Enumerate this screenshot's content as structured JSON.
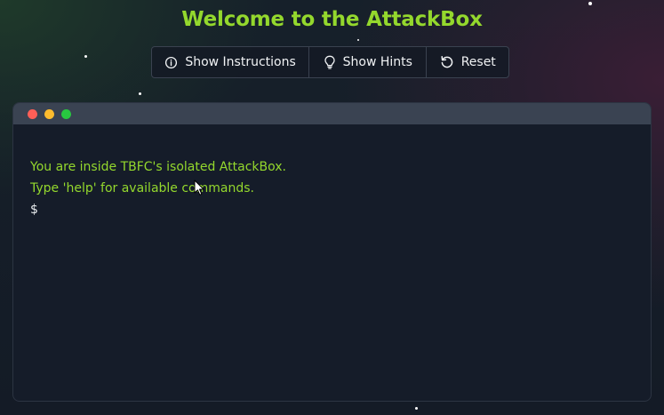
{
  "page": {
    "title": "Welcome to the AttackBox"
  },
  "toolbar": {
    "buttons": [
      {
        "label": "Show Instructions",
        "icon": "info-icon"
      },
      {
        "label": "Show Hints",
        "icon": "lightbulb-icon"
      },
      {
        "label": "Reset",
        "icon": "reset-icon"
      }
    ]
  },
  "terminal": {
    "window_buttons": [
      {
        "name": "close",
        "color": "#ff5f57"
      },
      {
        "name": "minimize",
        "color": "#febc2e"
      },
      {
        "name": "maximize",
        "color": "#28c840"
      }
    ],
    "lines": [
      "You are inside TBFC's isolated AttackBox.",
      "Type 'help' for available commands."
    ],
    "prompt": "$"
  },
  "colors": {
    "accent": "#94d82d",
    "terminal_bg": "#151c29",
    "terminal_bar": "#3a4352"
  }
}
